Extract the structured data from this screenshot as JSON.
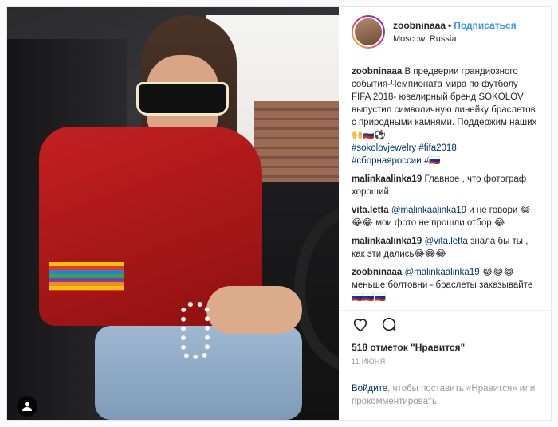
{
  "header": {
    "username": "zoobninaaa",
    "separator": "•",
    "follow_label": "Подписаться",
    "location": "Moscow, Russia"
  },
  "caption": {
    "username": "zoobninaaa",
    "text": "В предверии грандиозного события-Чемпионата мира по футболу FIFA 2018- ювелирный бренд SOKOLOV выпустил символичную линейку браслетов с природными камнями. Поддержим наших🙌🇷🇺⚽",
    "hashtags": [
      "#sokolovjewelry",
      "#fifa2018",
      "#сборнаяроссии",
      "#🇷🇺"
    ]
  },
  "comments": [
    {
      "username": "malinkaalinka19",
      "mention": "",
      "text": "Главное , что фотограф хороший"
    },
    {
      "username": "vita.letta",
      "mention": "@malinkaalinka19",
      "text": "и не говори 😂😂😂 мои фото не прошли отбор 😂"
    },
    {
      "username": "malinkaalinka19",
      "mention": "@vita.letta",
      "text": "знала бы ты , как эти дались😂😂😂"
    },
    {
      "username": "zoobninaaa",
      "mention": "@malinkaalinka19",
      "text": "😂😂😂 меньше болтовни - браслеты заказывайте🇷🇺🇷🇺🇷🇺"
    }
  ],
  "likes_text": "518 отметок \"Нравится\"",
  "date": "11 июня",
  "login": {
    "link": "Войдите",
    "text": ", чтобы поставить «Нравится» или прокомментировать."
  },
  "icons": {
    "like": "heart-icon",
    "comment": "comment-icon",
    "tagged_user": "user-tag-icon"
  },
  "colors": {
    "link_blue": "#3897f0",
    "tag_blue": "#003569"
  }
}
